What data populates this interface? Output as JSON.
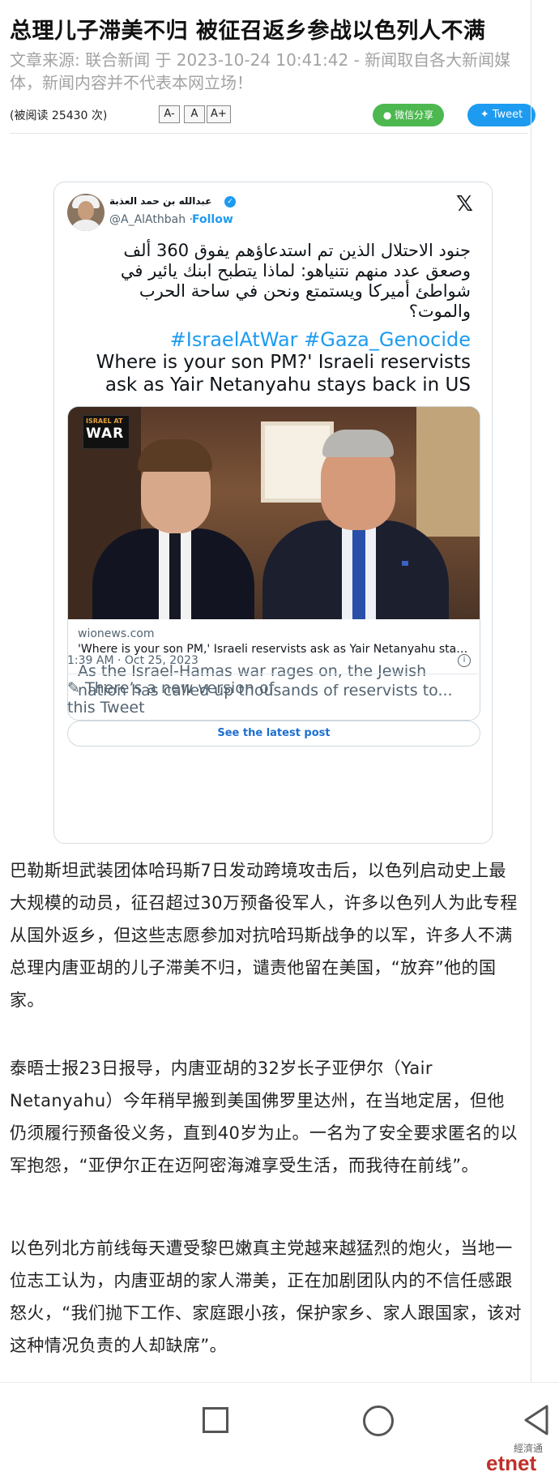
{
  "article": {
    "title": "总理儿子滞美不归 被征召返乡参战以色列人不满",
    "meta": "文章来源: 联合新闻 于 2023-10-24 10:41:42 - 新闻取自各大新闻媒体，新闻内容并不代表本网立场！"
  },
  "toolbar": {
    "read_count": "(被阅读 25430 次)",
    "font_small": "A-",
    "font_normal": "A",
    "font_large": "A+",
    "wechat_share": "微信分享",
    "tweet": "Tweet"
  },
  "tweet": {
    "author_name": "عبدالله بن حمد العذبة",
    "handle": "@A_AlAthbah ·",
    "follow": "Follow",
    "x_logo": "𝕏",
    "arabic_text": "جنود الاحتلال الذين تم استدعاؤهم يفوق 360 ألف وصعق عدد منهم نتنياهو: لماذا يتطبح ابنك يائير في شواطئ أميركا ويستمتع ونحن في ساحة الحرب والموت؟",
    "hashtags": "#IsraelAtWar #Gaza_Genocide",
    "text_en": "Where is your son PM?' Israeli reservists ask as Yair Netanyahu stays back in US",
    "badge_top": "ISRAEL AT",
    "badge_war": "WAR",
    "link_domain": "wionews.com",
    "link_title": "'Where is your son PM,' Israeli reservists ask as Yair Netanyahu stays...",
    "link_desc": "As the Israel-Hamas war rages on, the Jewish nation has called up thousands of reservists to...",
    "timestamp": "1:39 AM · Oct 25, 2023",
    "info": "i",
    "new_version": "There’s a new version of this Tweet",
    "see_latest": "See the latest post"
  },
  "body": {
    "p1": "巴勒斯坦武装团体哈玛斯7日发动跨境攻击后，以色列启动史上最大规模的动员，征召超过30万预备役军人，许多以色列人为此专程从国外返乡，但这些志愿参加对抗哈玛斯战争的以军，许多人不满总理内唐亚胡的儿子滞美不归，谴责他留在美国，“放弃”他的国家。",
    "p2": "泰晤士报23日报导，内唐亚胡的32岁长子亚伊尔（Yair Netanyahu）今年稍早搬到美国佛罗里达州，在当地定居，但他仍须履行预备役义务，直到40岁为止。一名为了安全要求匿名的以军抱怨，“亚伊尔正在迈阿密海滩享受生活，而我待在前线”。",
    "p3": "以色列北方前线每天遭受黎巴嫩真主党越来越猛烈的炮火，当地一位志工认为，内唐亚胡的家人滞美，正在加剧团队内的不信任感跟怒火，“我们抛下工作、家庭跟小孩，保护家乡、家人跟国家，该对这种情况负责的人却缺席”。"
  },
  "watermark": {
    "small": "經濟通",
    "brand": "etnet"
  }
}
